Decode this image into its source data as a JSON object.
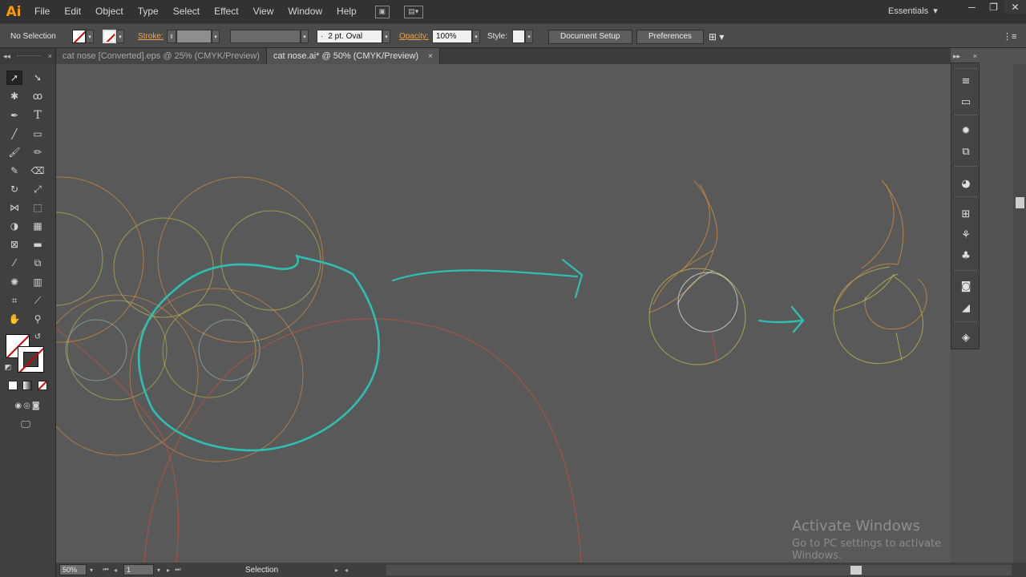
{
  "app": {
    "logo": "Ai"
  },
  "menu": {
    "items": [
      "File",
      "Edit",
      "Object",
      "Type",
      "Select",
      "Effect",
      "View",
      "Window",
      "Help"
    ],
    "workspace": "Essentials",
    "window_controls": [
      "─",
      "❐",
      "✕"
    ]
  },
  "control_bar": {
    "selection_state": "No Selection",
    "stroke_label": "Stroke:",
    "brush_value": "2 pt. Oval",
    "opacity_label": "Opacity:",
    "opacity_value": "100%",
    "style_label": "Style:",
    "document_setup": "Document Setup",
    "preferences": "Preferences"
  },
  "tabs": [
    {
      "label": "cat nose [Converted].eps @ 25% (CMYK/Preview)",
      "active": false
    },
    {
      "label": "cat nose.ai* @ 50% (CMYK/Preview)",
      "active": true,
      "close": "×"
    }
  ],
  "tools_panel": {
    "collapse": "◂◂",
    "close": "×"
  },
  "right_panel": {
    "expand": "▸▸",
    "close": "×",
    "icons": [
      "menu-icon",
      "gradient-icon",
      "color-guide-icon",
      "transform-icon",
      "appearance-icon",
      "align-icon",
      "brushes-icon",
      "symbols-icon",
      "graphic-styles-icon",
      "transparency-icon",
      "layers-icon"
    ]
  },
  "status_bar": {
    "zoom": "50%",
    "artboard": "1",
    "tool_status": "Selection"
  },
  "watermark": {
    "title": "Activate Windows",
    "subtitle": "Go to PC settings to activate Windows."
  },
  "colors": {
    "teal_stroke": "#2ebfb3",
    "orange_stroke": "#d88a3a",
    "yellow_stroke": "#b8b650",
    "red_stroke": "#c2503d",
    "accent_logo": "#ff9a00"
  }
}
